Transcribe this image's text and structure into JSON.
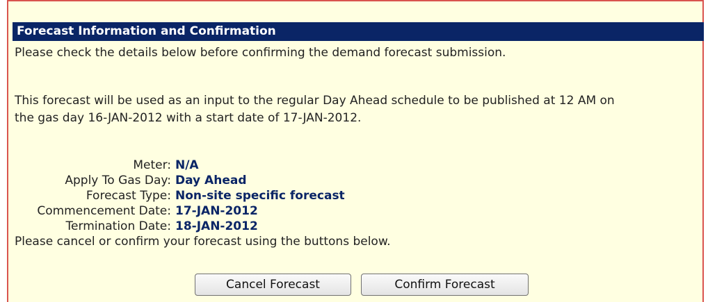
{
  "panel": {
    "title": "Forecast Information and Confirmation",
    "intro": "Please check the details below before confirming the demand forecast submission.",
    "info_line1": "This forecast will be used as an input to the regular Day Ahead schedule to be published at 12 AM on",
    "info_line2": "the gas day 16-JAN-2012 with a start date of 17-JAN-2012.",
    "fields": [
      {
        "label": "Meter:",
        "value": "N/A"
      },
      {
        "label": "Apply To Gas Day:",
        "value": "Day Ahead"
      },
      {
        "label": "Forecast Type:",
        "value": "Non-site specific forecast"
      },
      {
        "label": "Commencement Date:",
        "value": "17-JAN-2012"
      },
      {
        "label": "Termination Date:",
        "value": "18-JAN-2012"
      }
    ],
    "instruction": "Please cancel or confirm your forecast using the buttons below.",
    "cancel_label": "Cancel Forecast",
    "confirm_label": "Confirm Forecast"
  },
  "colors": {
    "header_bg": "#0a2566",
    "panel_bg": "#ffffe1",
    "border": "#d9534f",
    "value_text": "#0a2566"
  }
}
